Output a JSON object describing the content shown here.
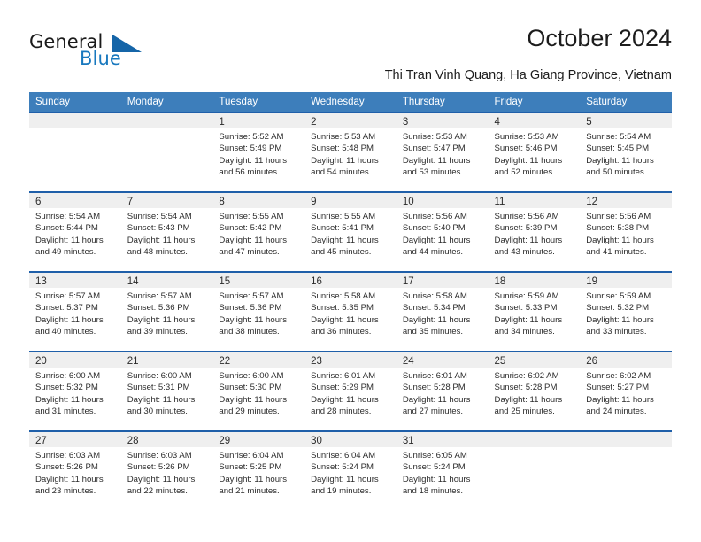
{
  "brand": {
    "name_part1": "General",
    "name_part2": "Blue",
    "triangle_icon": "triangle-icon",
    "accent_color": "#1878be",
    "dark_color": "#1565a8"
  },
  "header": {
    "title": "October 2024",
    "subtitle": "Thi Tran Vinh Quang, Ha Giang Province, Vietnam"
  },
  "theme": {
    "header_blue": "#3d7ebb",
    "separator_blue": "#1f5fa9",
    "daynum_band": "#efefef",
    "body_bg": "#ffffff"
  },
  "weekday_headers": [
    "Sunday",
    "Monday",
    "Tuesday",
    "Wednesday",
    "Thursday",
    "Friday",
    "Saturday"
  ],
  "weeks": [
    {
      "days": [
        {
          "date": "",
          "empty": true,
          "l1": "",
          "l2": "",
          "l3": "",
          "l4": ""
        },
        {
          "date": "",
          "empty": true,
          "l1": "",
          "l2": "",
          "l3": "",
          "l4": ""
        },
        {
          "date": "1",
          "empty": false,
          "l1": "Sunrise: 5:52 AM",
          "l2": "Sunset: 5:49 PM",
          "l3": "Daylight: 11 hours",
          "l4": "and 56 minutes."
        },
        {
          "date": "2",
          "empty": false,
          "l1": "Sunrise: 5:53 AM",
          "l2": "Sunset: 5:48 PM",
          "l3": "Daylight: 11 hours",
          "l4": "and 54 minutes."
        },
        {
          "date": "3",
          "empty": false,
          "l1": "Sunrise: 5:53 AM",
          "l2": "Sunset: 5:47 PM",
          "l3": "Daylight: 11 hours",
          "l4": "and 53 minutes."
        },
        {
          "date": "4",
          "empty": false,
          "l1": "Sunrise: 5:53 AM",
          "l2": "Sunset: 5:46 PM",
          "l3": "Daylight: 11 hours",
          "l4": "and 52 minutes."
        },
        {
          "date": "5",
          "empty": false,
          "l1": "Sunrise: 5:54 AM",
          "l2": "Sunset: 5:45 PM",
          "l3": "Daylight: 11 hours",
          "l4": "and 50 minutes."
        }
      ]
    },
    {
      "days": [
        {
          "date": "6",
          "empty": false,
          "l1": "Sunrise: 5:54 AM",
          "l2": "Sunset: 5:44 PM",
          "l3": "Daylight: 11 hours",
          "l4": "and 49 minutes."
        },
        {
          "date": "7",
          "empty": false,
          "l1": "Sunrise: 5:54 AM",
          "l2": "Sunset: 5:43 PM",
          "l3": "Daylight: 11 hours",
          "l4": "and 48 minutes."
        },
        {
          "date": "8",
          "empty": false,
          "l1": "Sunrise: 5:55 AM",
          "l2": "Sunset: 5:42 PM",
          "l3": "Daylight: 11 hours",
          "l4": "and 47 minutes."
        },
        {
          "date": "9",
          "empty": false,
          "l1": "Sunrise: 5:55 AM",
          "l2": "Sunset: 5:41 PM",
          "l3": "Daylight: 11 hours",
          "l4": "and 45 minutes."
        },
        {
          "date": "10",
          "empty": false,
          "l1": "Sunrise: 5:56 AM",
          "l2": "Sunset: 5:40 PM",
          "l3": "Daylight: 11 hours",
          "l4": "and 44 minutes."
        },
        {
          "date": "11",
          "empty": false,
          "l1": "Sunrise: 5:56 AM",
          "l2": "Sunset: 5:39 PM",
          "l3": "Daylight: 11 hours",
          "l4": "and 43 minutes."
        },
        {
          "date": "12",
          "empty": false,
          "l1": "Sunrise: 5:56 AM",
          "l2": "Sunset: 5:38 PM",
          "l3": "Daylight: 11 hours",
          "l4": "and 41 minutes."
        }
      ]
    },
    {
      "days": [
        {
          "date": "13",
          "empty": false,
          "l1": "Sunrise: 5:57 AM",
          "l2": "Sunset: 5:37 PM",
          "l3": "Daylight: 11 hours",
          "l4": "and 40 minutes."
        },
        {
          "date": "14",
          "empty": false,
          "l1": "Sunrise: 5:57 AM",
          "l2": "Sunset: 5:36 PM",
          "l3": "Daylight: 11 hours",
          "l4": "and 39 minutes."
        },
        {
          "date": "15",
          "empty": false,
          "l1": "Sunrise: 5:57 AM",
          "l2": "Sunset: 5:36 PM",
          "l3": "Daylight: 11 hours",
          "l4": "and 38 minutes."
        },
        {
          "date": "16",
          "empty": false,
          "l1": "Sunrise: 5:58 AM",
          "l2": "Sunset: 5:35 PM",
          "l3": "Daylight: 11 hours",
          "l4": "and 36 minutes."
        },
        {
          "date": "17",
          "empty": false,
          "l1": "Sunrise: 5:58 AM",
          "l2": "Sunset: 5:34 PM",
          "l3": "Daylight: 11 hours",
          "l4": "and 35 minutes."
        },
        {
          "date": "18",
          "empty": false,
          "l1": "Sunrise: 5:59 AM",
          "l2": "Sunset: 5:33 PM",
          "l3": "Daylight: 11 hours",
          "l4": "and 34 minutes."
        },
        {
          "date": "19",
          "empty": false,
          "l1": "Sunrise: 5:59 AM",
          "l2": "Sunset: 5:32 PM",
          "l3": "Daylight: 11 hours",
          "l4": "and 33 minutes."
        }
      ]
    },
    {
      "days": [
        {
          "date": "20",
          "empty": false,
          "l1": "Sunrise: 6:00 AM",
          "l2": "Sunset: 5:32 PM",
          "l3": "Daylight: 11 hours",
          "l4": "and 31 minutes."
        },
        {
          "date": "21",
          "empty": false,
          "l1": "Sunrise: 6:00 AM",
          "l2": "Sunset: 5:31 PM",
          "l3": "Daylight: 11 hours",
          "l4": "and 30 minutes."
        },
        {
          "date": "22",
          "empty": false,
          "l1": "Sunrise: 6:00 AM",
          "l2": "Sunset: 5:30 PM",
          "l3": "Daylight: 11 hours",
          "l4": "and 29 minutes."
        },
        {
          "date": "23",
          "empty": false,
          "l1": "Sunrise: 6:01 AM",
          "l2": "Sunset: 5:29 PM",
          "l3": "Daylight: 11 hours",
          "l4": "and 28 minutes."
        },
        {
          "date": "24",
          "empty": false,
          "l1": "Sunrise: 6:01 AM",
          "l2": "Sunset: 5:28 PM",
          "l3": "Daylight: 11 hours",
          "l4": "and 27 minutes."
        },
        {
          "date": "25",
          "empty": false,
          "l1": "Sunrise: 6:02 AM",
          "l2": "Sunset: 5:28 PM",
          "l3": "Daylight: 11 hours",
          "l4": "and 25 minutes."
        },
        {
          "date": "26",
          "empty": false,
          "l1": "Sunrise: 6:02 AM",
          "l2": "Sunset: 5:27 PM",
          "l3": "Daylight: 11 hours",
          "l4": "and 24 minutes."
        }
      ]
    },
    {
      "days": [
        {
          "date": "27",
          "empty": false,
          "l1": "Sunrise: 6:03 AM",
          "l2": "Sunset: 5:26 PM",
          "l3": "Daylight: 11 hours",
          "l4": "and 23 minutes."
        },
        {
          "date": "28",
          "empty": false,
          "l1": "Sunrise: 6:03 AM",
          "l2": "Sunset: 5:26 PM",
          "l3": "Daylight: 11 hours",
          "l4": "and 22 minutes."
        },
        {
          "date": "29",
          "empty": false,
          "l1": "Sunrise: 6:04 AM",
          "l2": "Sunset: 5:25 PM",
          "l3": "Daylight: 11 hours",
          "l4": "and 21 minutes."
        },
        {
          "date": "30",
          "empty": false,
          "l1": "Sunrise: 6:04 AM",
          "l2": "Sunset: 5:24 PM",
          "l3": "Daylight: 11 hours",
          "l4": "and 19 minutes."
        },
        {
          "date": "31",
          "empty": false,
          "l1": "Sunrise: 6:05 AM",
          "l2": "Sunset: 5:24 PM",
          "l3": "Daylight: 11 hours",
          "l4": "and 18 minutes."
        },
        {
          "date": "",
          "empty": true,
          "l1": "",
          "l2": "",
          "l3": "",
          "l4": ""
        },
        {
          "date": "",
          "empty": true,
          "l1": "",
          "l2": "",
          "l3": "",
          "l4": ""
        }
      ]
    }
  ]
}
